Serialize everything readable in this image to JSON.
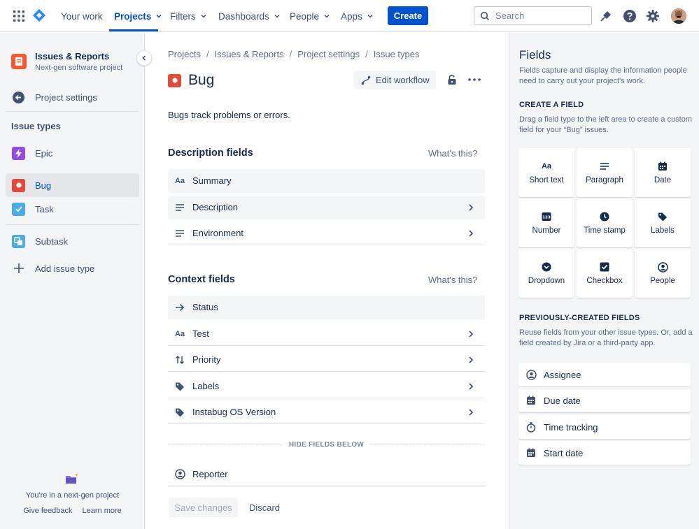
{
  "nav": {
    "items": [
      "Your work",
      "Projects",
      "Filters",
      "Dashboards",
      "People",
      "Apps"
    ],
    "create_label": "Create",
    "search_placeholder": "Search"
  },
  "sidebar": {
    "project_name": "Issues & Reports",
    "project_type": "Next-gen software project",
    "project_settings": "Project settings",
    "section_title": "Issue types",
    "issue_types": [
      "Epic",
      "Bug",
      "Task"
    ],
    "subtask": "Subtask",
    "add_issue_type": "Add issue type",
    "footer_text": "You're in a next-gen project",
    "give_feedback": "Give feedback",
    "learn_more": "Learn more"
  },
  "main": {
    "breadcrumb": [
      "Projects",
      "Issues & Reports",
      "Project settings",
      "Issue types"
    ],
    "breadcrumb_separator": "/",
    "title": "Bug",
    "edit_workflow": "Edit workflow",
    "description": "Bugs track problems or errors.",
    "description_fields_title": "Description fields",
    "whats_this": "What's this?",
    "description_fields": [
      "Summary",
      "Description",
      "Environment"
    ],
    "context_fields_title": "Context fields",
    "context_fields": [
      "Status",
      "Test",
      "Priority",
      "Labels",
      "Instabug OS Version"
    ],
    "hide_fields_below": "HIDE FIELDS BELOW",
    "hidden_fields": [
      "Reporter"
    ],
    "save_changes": "Save changes",
    "discard": "Discard"
  },
  "right_panel": {
    "title": "Fields",
    "description": "Fields capture and display the information people need to carry out your project's work.",
    "create_heading": "CREATE A FIELD",
    "create_desc": "Drag a field type to the left area to create a custom field for your “Bug” issues.",
    "field_types": [
      "Short text",
      "Paragraph",
      "Date",
      "Number",
      "Time stamp",
      "Labels",
      "Dropdown",
      "Checkbox",
      "People"
    ],
    "prev_heading": "PREVIOUSLY-CREATED FIELDS",
    "prev_desc": "Reuse fields from your other issue types. Or, add a field created by Jira or a third-party app.",
    "prev_fields": [
      "Assignee",
      "Due date",
      "Time tracking",
      "Start date"
    ]
  },
  "icons": {
    "text_glyph": "Aa",
    "number_glyph": "123"
  },
  "colors": {
    "brand": "#0052cc",
    "bug": "#e5493a",
    "epic": "#904ee2",
    "task": "#4bade8"
  }
}
